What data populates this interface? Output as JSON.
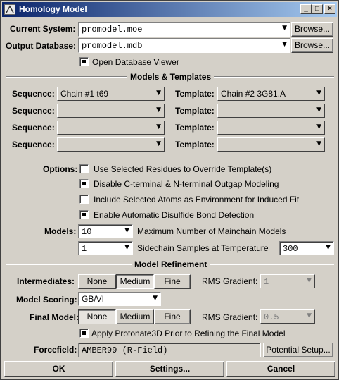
{
  "window": {
    "title": "Homology Model"
  },
  "title_buttons": {
    "minimize": "_",
    "maximize": "□",
    "close": "×"
  },
  "system": {
    "current_label": "Current System:",
    "current_value": "promodel.moe",
    "output_label": "Output Database:",
    "output_value": "promodel.mdb",
    "browse": "Browse...",
    "open_viewer": "Open Database Viewer",
    "open_viewer_checked": true
  },
  "models_templates": {
    "title": "Models & Templates",
    "sequence_label": "Sequence:",
    "template_label": "Template:",
    "rows": [
      {
        "sequence": "Chain #1  t69",
        "template": "Chain #2  3G81.A"
      },
      {
        "sequence": "",
        "template": ""
      },
      {
        "sequence": "",
        "template": ""
      },
      {
        "sequence": "",
        "template": ""
      }
    ]
  },
  "options": {
    "label": "Options:",
    "items": [
      {
        "label": "Use Selected Residues to Override Template(s)",
        "checked": false
      },
      {
        "label": "Disable C-terminal & N-terminal Outgap Modeling",
        "checked": true
      },
      {
        "label": "Include Selected Atoms as Environment for Induced Fit",
        "checked": false
      },
      {
        "label": "Enable Automatic Disulfide Bond Detection",
        "checked": true
      }
    ]
  },
  "models": {
    "label": "Models:",
    "mainchain_value": "10",
    "mainchain_label": "Maximum Number of Mainchain Models",
    "sidechain_value": "1",
    "sidechain_label": "Sidechain Samples at Temperature",
    "temperature": "300"
  },
  "refinement": {
    "title": "Model Refinement",
    "intermediates_label": "Intermediates:",
    "final_label": "Final Model:",
    "levels": [
      "None",
      "Medium",
      "Fine"
    ],
    "intermediates_selected": "Medium",
    "final_selected": "None",
    "rms_label": "RMS Gradient:",
    "intermediates_rms": "1",
    "final_rms": "0.5",
    "scoring_label": "Model Scoring:",
    "scoring_value": "GB/VI",
    "protonate_label": "Apply Protonate3D Prior to Refining the Final Model",
    "protonate_checked": true,
    "forcefield_label": "Forcefield:",
    "forcefield_value": "AMBER99 (R-Field)",
    "potential_setup": "Potential Setup..."
  },
  "footer": {
    "ok": "OK",
    "settings": "Settings...",
    "cancel": "Cancel"
  }
}
